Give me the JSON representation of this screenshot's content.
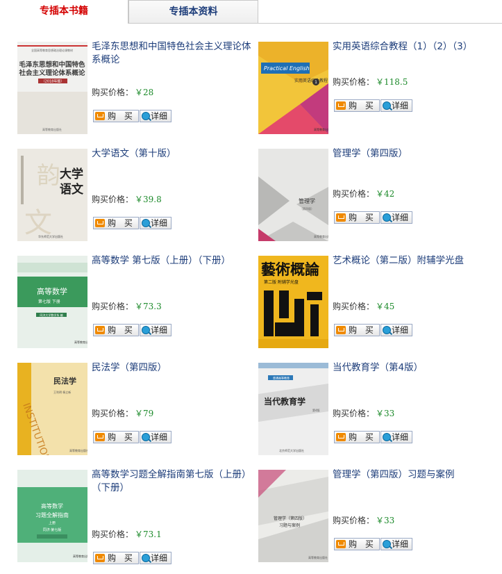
{
  "tabs": {
    "books": "专插本书籍",
    "materials": "专插本资料"
  },
  "labels": {
    "price": "购买价格：",
    "buy": "购 买",
    "details": "详细"
  },
  "colors": {
    "title_link": "#1d3d7a",
    "price_value": "#1c8a2a",
    "active_tab": "#d40000"
  },
  "books": [
    {
      "title": "毛泽东思想和中国特色社会主义理论体系概论",
      "price": "￥28",
      "cover": {
        "main": "毛泽东思想和中国特色社会主义理论体系概论",
        "sub": "（2018年版）"
      }
    },
    {
      "title": "实用英语综合教程（1）（2）（3）",
      "price": "￥118.5",
      "cover": {
        "main": "Practical English",
        "sub": "实用英语综合教程"
      }
    },
    {
      "title": "大学语文（第十版）",
      "price": "￥39.8",
      "cover": {
        "main": "大学语文",
        "sub": ""
      }
    },
    {
      "title": "管理学（第四版）",
      "price": "￥42",
      "cover": {
        "main": "管理学",
        "sub": ""
      }
    },
    {
      "title": "高等数学 第七版（上册）（下册）",
      "price": "￥73.3",
      "cover": {
        "main": "高等数学",
        "sub": "第七版 下册"
      }
    },
    {
      "title": "艺术概论（第二版）附辅学光盘",
      "price": "￥45",
      "cover": {
        "main": "藝術概論",
        "sub": "第二版 附辅学光盘"
      }
    },
    {
      "title": "民法学（第四版）",
      "price": "￥79",
      "cover": {
        "main": "民法学",
        "sub": "INSTITUTIONES"
      }
    },
    {
      "title": "当代教育学（第4版）",
      "price": "￥33",
      "cover": {
        "main": "当代教育学",
        "sub": "第4版"
      }
    },
    {
      "title": "高等数学习题全解指南第七版（上册）（下册）",
      "price": "￥73.1",
      "cover": {
        "main": "高等数学 习题全解指南",
        "sub": "上册 同济·第七版"
      }
    },
    {
      "title": "管理学（第四版）习题与案例",
      "price": "￥33",
      "cover": {
        "main": "管理学（第四版）习题与案例",
        "sub": ""
      }
    }
  ]
}
